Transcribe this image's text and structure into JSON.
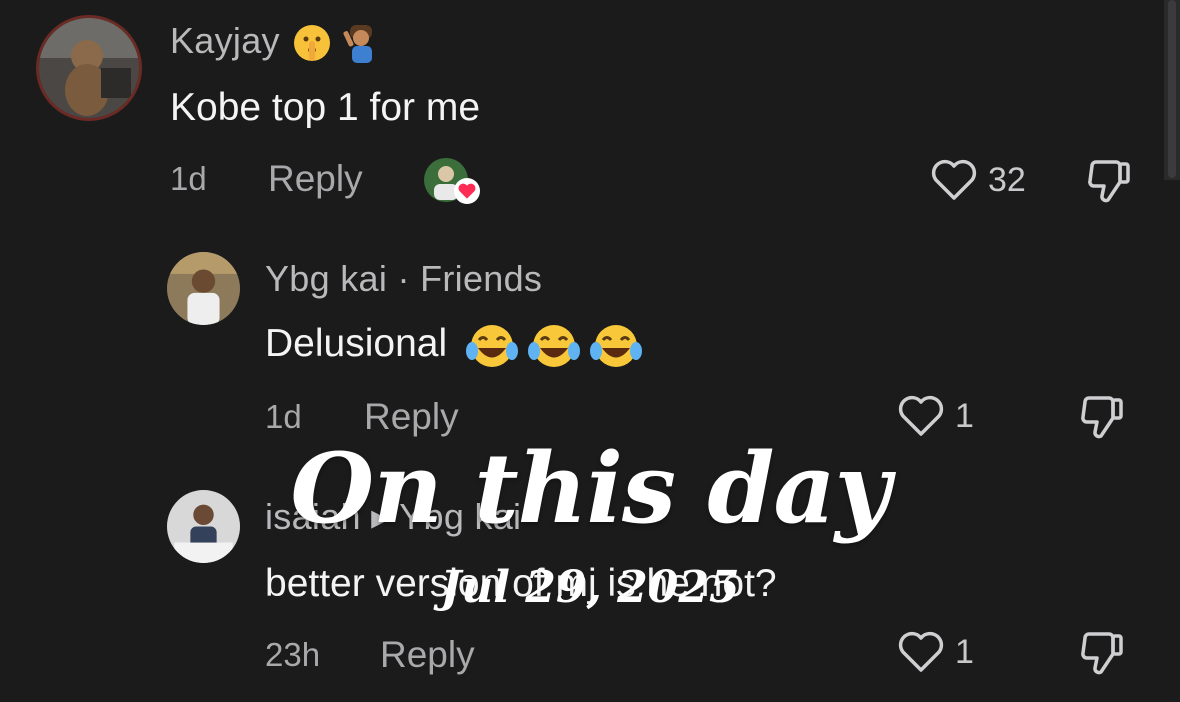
{
  "comments": [
    {
      "username": "Kayjay",
      "username_emojis": [
        "shushing-face",
        "person-shushing"
      ],
      "text": "Kobe top 1 for me",
      "age": "1d",
      "reply_label": "Reply",
      "likes": "32",
      "creator_liked": true
    },
    {
      "username": "Ybg kai · Friends",
      "text": "Delusional",
      "text_emojis": [
        "tears-of-joy",
        "tears-of-joy",
        "tears-of-joy"
      ],
      "age": "1d",
      "reply_label": "Reply",
      "likes": "1"
    },
    {
      "username": "isaiah ▸ Ybg kai",
      "text": "better version of mj is he not?",
      "age": "23h",
      "reply_label": "Reply",
      "likes": "1"
    }
  ],
  "overlay": {
    "title": "On this day",
    "date": "Jul 29, 2025"
  },
  "colors": {
    "background": "#1b1b1c",
    "heart_badge": "#fe2c55"
  }
}
